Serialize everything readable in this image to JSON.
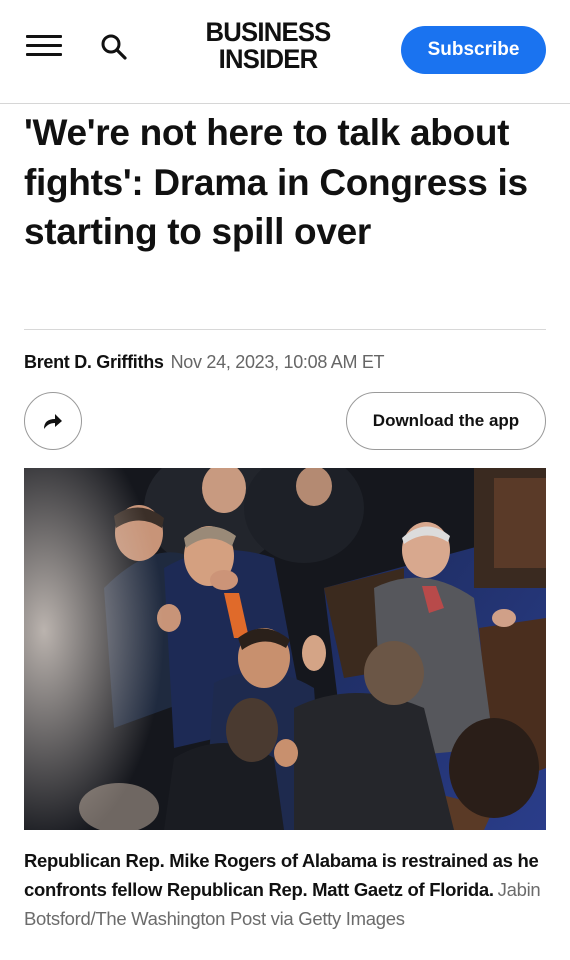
{
  "header": {
    "logo_line1": "BUSINESS",
    "logo_line2": "INSIDER",
    "subscribe_label": "Subscribe",
    "menu_icon": "hamburger-menu-icon",
    "search_icon": "search-icon",
    "accent_color": "#1a73f0"
  },
  "article": {
    "headline": "'We're not here to talk about fights': Drama in Congress is starting to spill over",
    "author": "Brent D. Griffiths",
    "date": "Nov 24, 2023, 10:08 AM ET",
    "share_icon": "share-arrow-icon",
    "download_label": "Download the app",
    "caption": "Republican Rep. Mike Rogers of Alabama is restrained as he confronts fellow Republican Rep. Matt Gaetz of Florida.",
    "credit": "Jabin Botsford/The Washington Post via Getty Images"
  }
}
